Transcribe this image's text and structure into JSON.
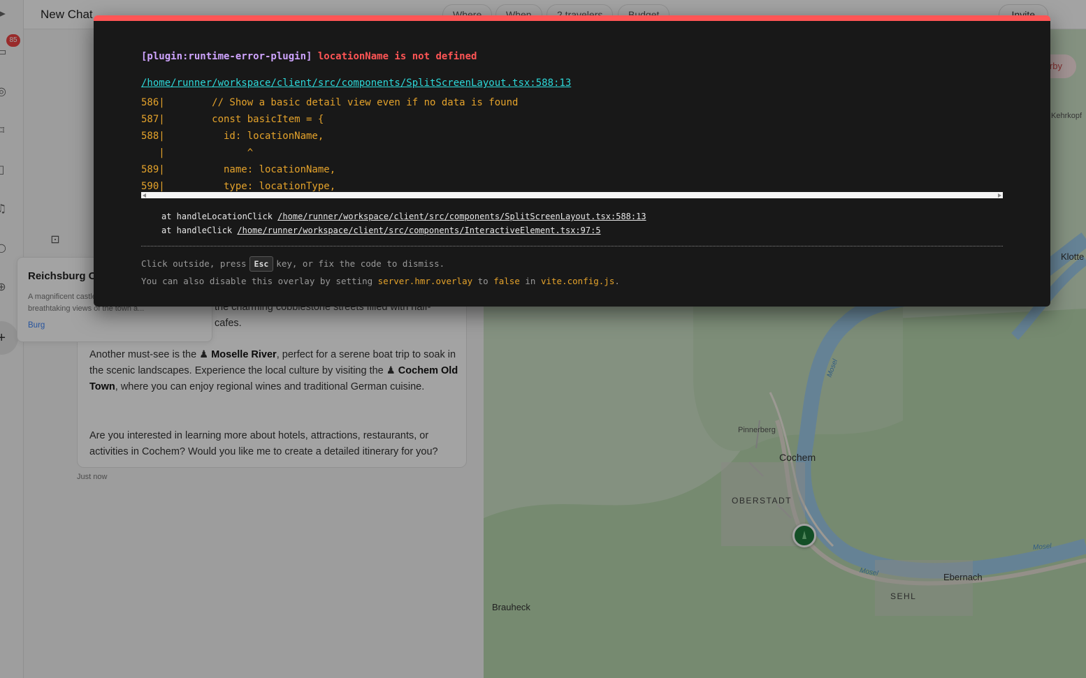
{
  "app": {
    "chat_title": "New Chat",
    "filters": [
      "Where",
      "When",
      "2 travelers",
      "Budget"
    ],
    "invite_label": "Invite",
    "notification_count": "85"
  },
  "location_card": {
    "name": "Reichsburg Cochem",
    "description": "A magnificent castle offering breathtaking views of the town a...",
    "tag": "Burg"
  },
  "message": {
    "partial_line_1": "the charming cobblestone streets filled with half-",
    "partial_line_2": "cafes.",
    "p2_before": "Another must-see is the ",
    "p2_river": "Moselle River",
    "p2_mid": ", perfect for a serene boat trip to soak in the scenic landscapes. Experience the local culture by visiting the ",
    "p2_oldtown": "Cochem Old Town",
    "p2_after": ", where you can enjoy regional wines and traditional German cuisine.",
    "p3": "Are you interested in learning more about hotels, attractions, restaurants, or activities in Cochem? Would you like me to create a detailed itinerary for you?",
    "timestamp": "Just now"
  },
  "map": {
    "nearby_label": "earby",
    "labels": {
      "kehrkopf": "Kehrkopf",
      "klotten": "Klotte",
      "pinnerberg": "Pinnerberg",
      "cochem": "Cochem",
      "oberstadt": "OBERSTADT",
      "ebernach": "Ebernach",
      "sehl": "SEHL",
      "brauheck": "Brauheck",
      "mosel_1": "Mosel",
      "mosel_2": "Mosel",
      "mosel_3": "Mosel"
    }
  },
  "overlay": {
    "plugin": "[plugin:runtime-error-plugin]",
    "message": "locationName is not defined",
    "file": "/home/runner/workspace/client/src/components/SplitScreenLayout.tsx:588:13",
    "frame_lines": [
      "586|        // Show a basic detail view even if no data is found",
      "587|        const basicItem = {",
      "588|          id: locationName,",
      "   |              ^",
      "589|          name: locationName,",
      "590|          type: locationType,"
    ],
    "stack": [
      {
        "prefix": "at handleLocationClick ",
        "file": "/home/runner/workspace/client/src/components/SplitScreenLayout.tsx:588:13"
      },
      {
        "prefix": "at handleClick ",
        "file": "/home/runner/workspace/client/src/components/InteractiveElement.tsx:97:5"
      }
    ],
    "tip1_before": "Click outside, press",
    "tip1_key": "Esc",
    "tip1_after": "key, or fix the code to dismiss.",
    "tip2_a": "You can also disable this overlay by setting ",
    "tip2_b": "server.hmr.overlay",
    "tip2_c": " to ",
    "tip2_d": "false",
    "tip2_e": " in ",
    "tip2_f": "vite.config.js",
    "tip2_g": "."
  },
  "colors": {
    "overlay_bg": "#181818",
    "overlay_border": "#ff5555",
    "code": "#e5a32b",
    "link": "#2dd9da",
    "plugin": "#cfa4ff"
  }
}
